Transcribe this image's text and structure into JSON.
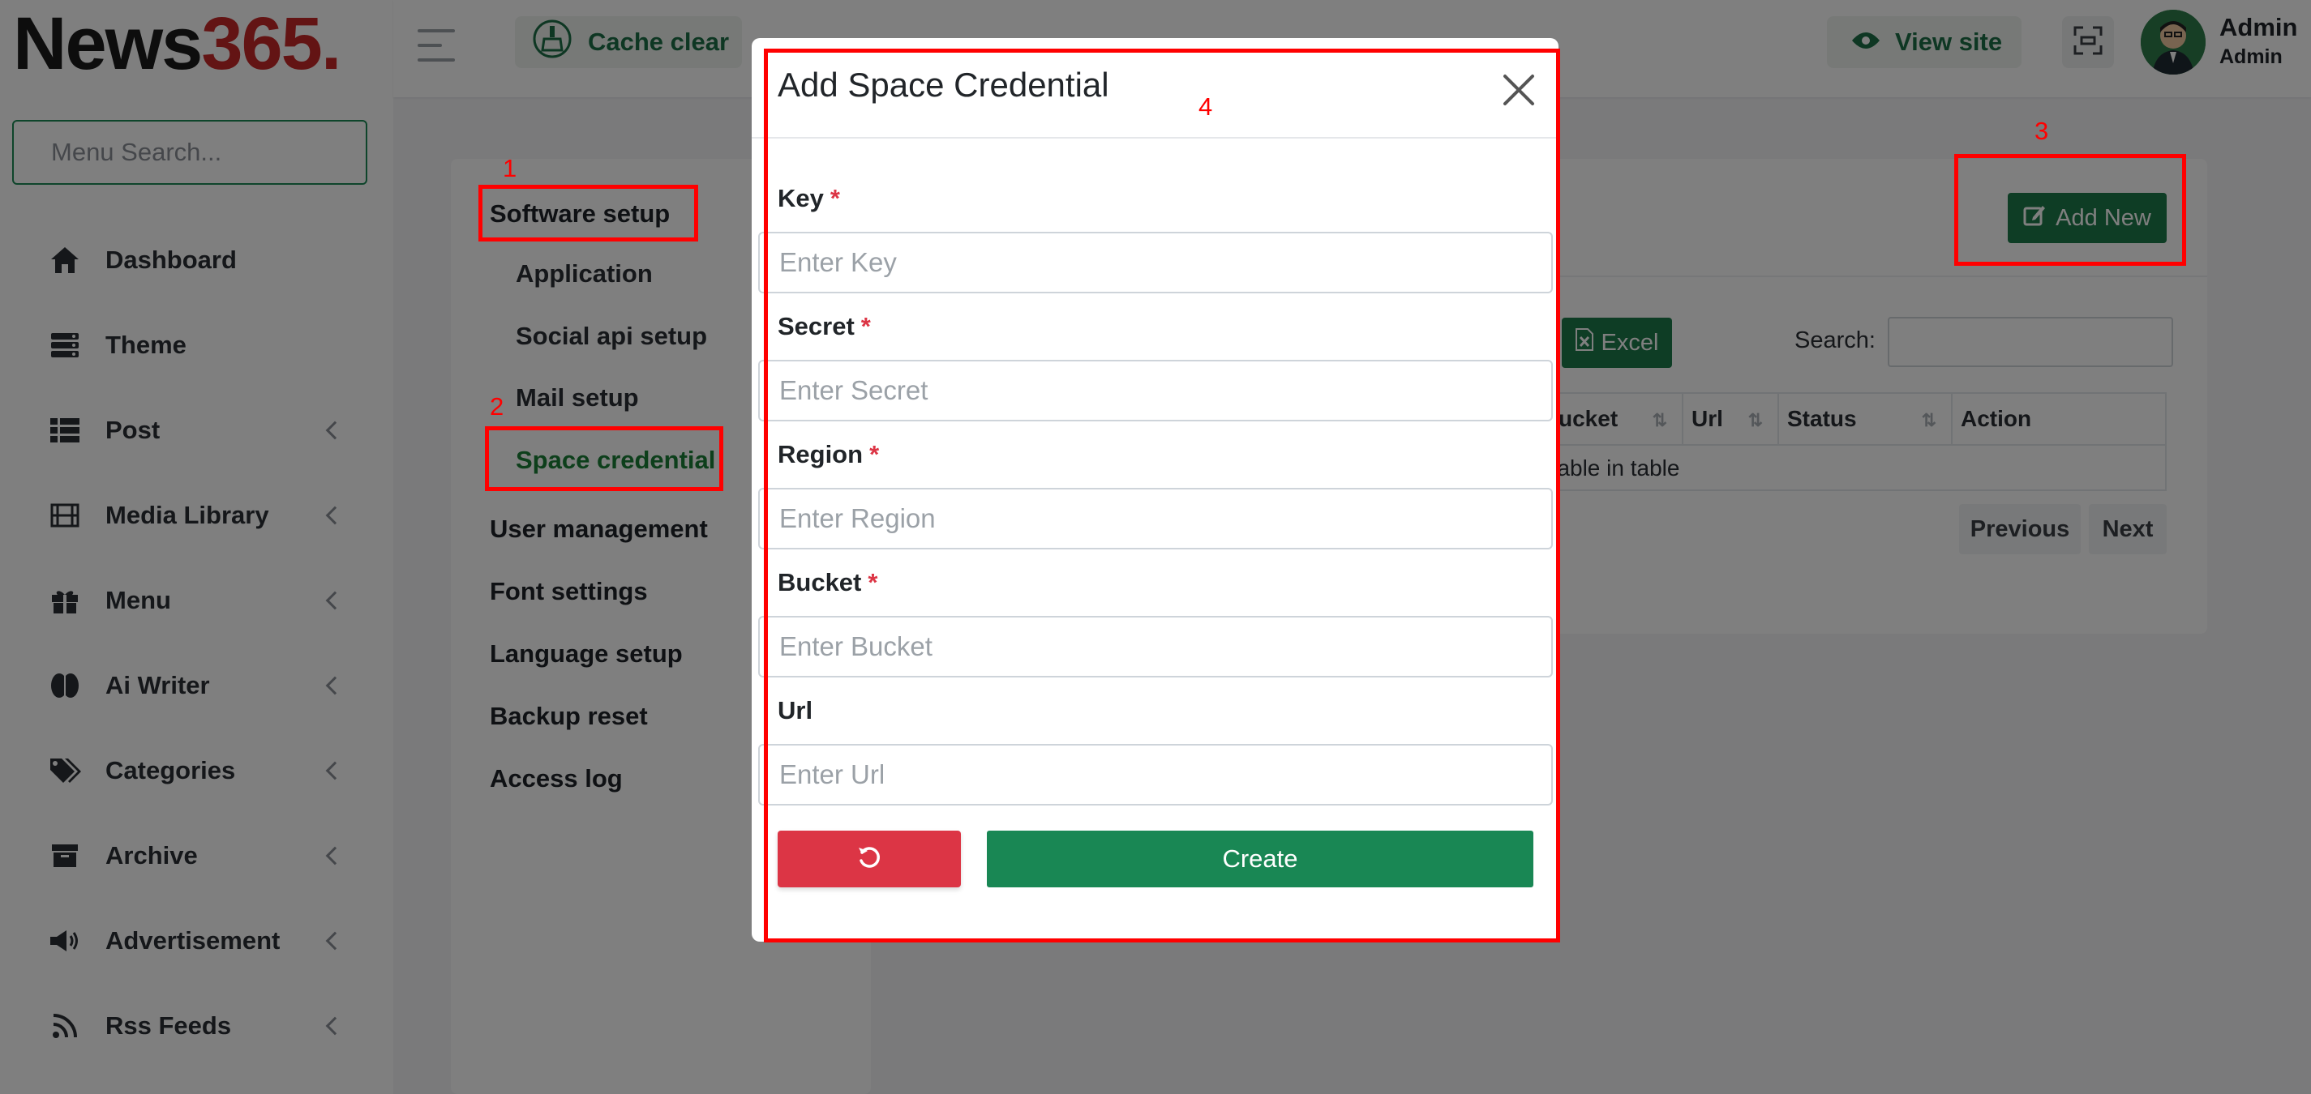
{
  "brand": {
    "name": "News",
    "accent": "365."
  },
  "sidebar": {
    "search_placeholder": "Menu Search...",
    "items": [
      {
        "label": "Dashboard",
        "icon": "home-icon",
        "has_submenu": false
      },
      {
        "label": "Theme",
        "icon": "layers-icon",
        "has_submenu": false
      },
      {
        "label": "Post",
        "icon": "list-icon",
        "has_submenu": true
      },
      {
        "label": "Media Library",
        "icon": "film-icon",
        "has_submenu": true
      },
      {
        "label": "Menu",
        "icon": "gift-icon",
        "has_submenu": true
      },
      {
        "label": "Ai Writer",
        "icon": "brain-icon",
        "has_submenu": true
      },
      {
        "label": "Categories",
        "icon": "tags-icon",
        "has_submenu": true
      },
      {
        "label": "Archive",
        "icon": "archive-icon",
        "has_submenu": true
      },
      {
        "label": "Advertisement",
        "icon": "megaphone-icon",
        "has_submenu": true
      },
      {
        "label": "Rss Feeds",
        "icon": "rss-icon",
        "has_submenu": true
      }
    ]
  },
  "topbar": {
    "cache_label": "Cache clear",
    "view_site_label": "View site",
    "user_name": "Admin",
    "user_role": "Admin"
  },
  "settings_menu": {
    "software_setup": "Software setup",
    "application": "Application",
    "social_api": "Social api setup",
    "mail_setup": "Mail setup",
    "space_credential": "Space credential",
    "user_management": "User management",
    "font_settings": "Font settings",
    "language_setup": "Language setup",
    "backup_reset": "Backup reset",
    "access_log": "Access log"
  },
  "content": {
    "add_new_label": "Add New",
    "excel_label": "Excel",
    "search_label": "Search:",
    "columns": [
      "ucket",
      "Url",
      "Status",
      "Action"
    ],
    "empty_text": "ilable in table",
    "prev_label": "Previous",
    "next_label": "Next"
  },
  "modal": {
    "title": "Add Space Credential",
    "fields": [
      {
        "label": "Key",
        "required": true,
        "placeholder": "Enter Key"
      },
      {
        "label": "Secret",
        "required": true,
        "placeholder": "Enter Secret"
      },
      {
        "label": "Region",
        "required": true,
        "placeholder": "Enter Region"
      },
      {
        "label": "Bucket",
        "required": true,
        "placeholder": "Enter Bucket"
      },
      {
        "label": "Url",
        "required": false,
        "placeholder": "Enter Url"
      }
    ],
    "required_mark": "*",
    "create_label": "Create"
  },
  "annotations": [
    "1",
    "2",
    "3",
    "4"
  ],
  "colors": {
    "primary_green": "#1d7a4b",
    "active_green": "#1a7f37",
    "danger": "#dc3545",
    "annotation_red": "#ff0000",
    "brand_red": "#c62828"
  }
}
